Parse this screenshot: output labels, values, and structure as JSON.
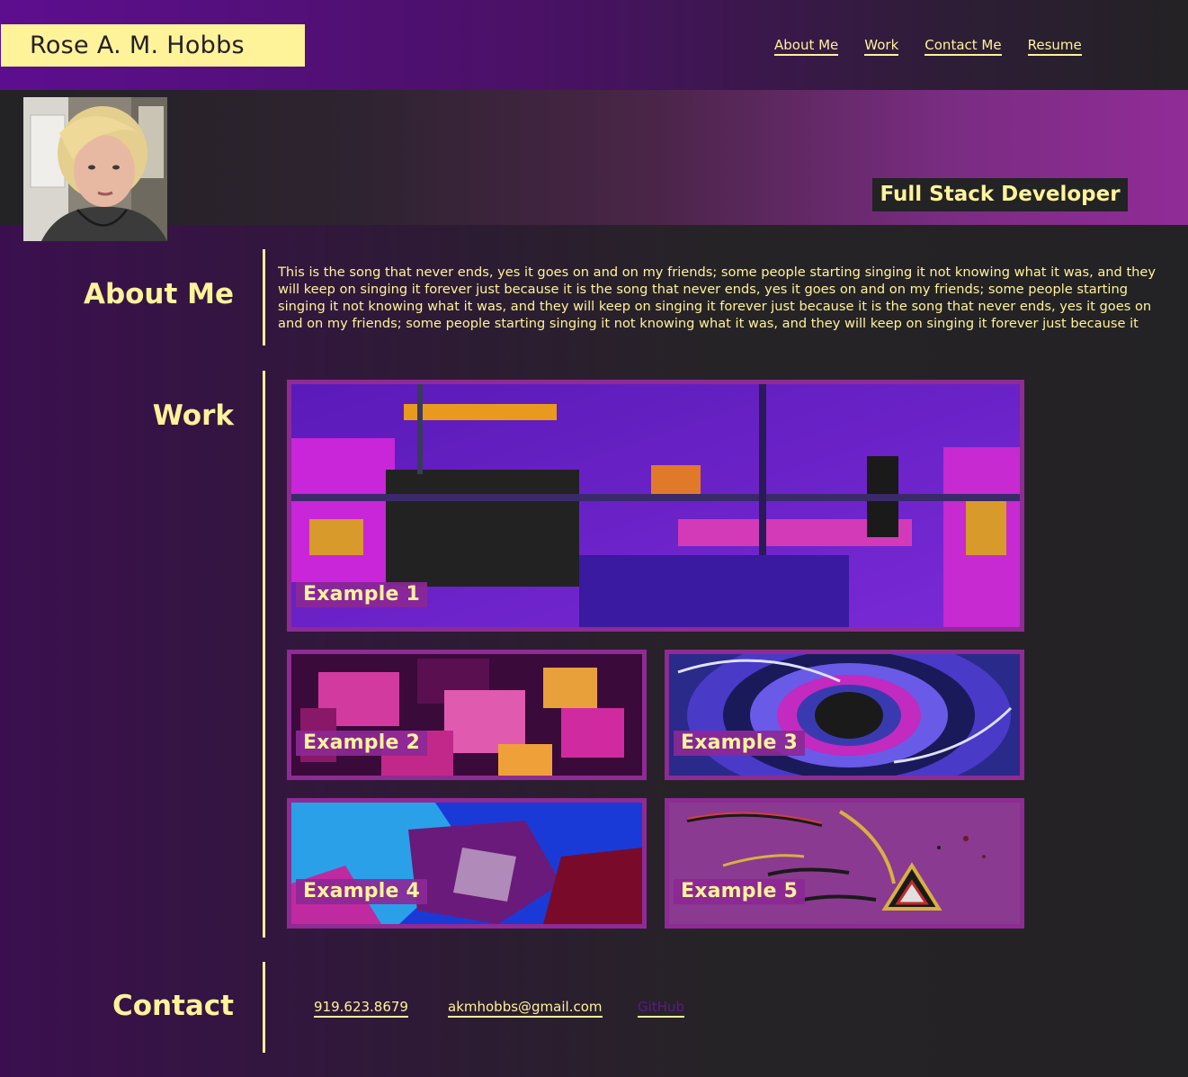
{
  "header": {
    "brand": "Rose A. M. Hobbs",
    "nav": [
      {
        "label": "About Me"
      },
      {
        "label": "Work"
      },
      {
        "label": "Contact Me"
      },
      {
        "label": "Resume"
      }
    ]
  },
  "hero": {
    "role": "Full Stack Developer",
    "avatar_alt": "portrait photo"
  },
  "about": {
    "title": "About Me",
    "text": "This is the song that never ends, yes it goes on and on my friends; some people starting singing it not knowing what it was, and they will keep on singing it forever just because it is the song that never ends, yes it goes on and on my friends; some people starting singing it not knowing what it was, and they will keep on singing it forever just because it is the song that never ends, yes it goes on and on my friends; some people starting singing it not knowing what it was, and they will keep on singing it forever just because it"
  },
  "work": {
    "title": "Work",
    "items": [
      {
        "label": "Example 1"
      },
      {
        "label": "Example 2"
      },
      {
        "label": "Example 3"
      },
      {
        "label": "Example 4"
      },
      {
        "label": "Example 5"
      }
    ]
  },
  "contact": {
    "title": "Contact",
    "phone": "919.623.8679",
    "email": "akmhobbs@gmail.com",
    "github": "GitHub"
  },
  "colors": {
    "accent": "#fff39a",
    "card_border": "#8e2b94",
    "dark": "#232224"
  }
}
